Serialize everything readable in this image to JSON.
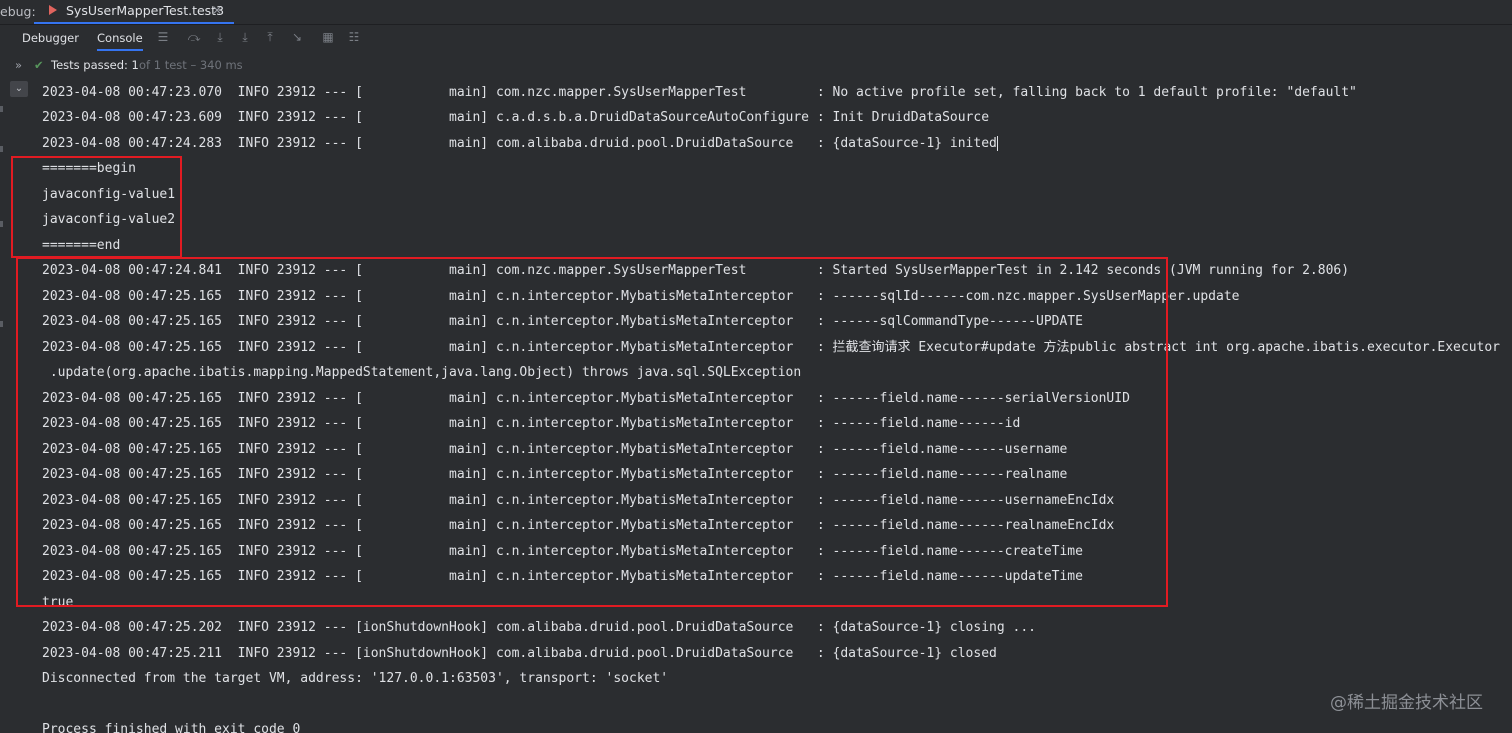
{
  "topbar": {
    "debug_label": "ebug:",
    "tab_label": "SysUserMapperTest.test3",
    "tab_close": "×"
  },
  "toolbar": {
    "debugger_label": "Debugger",
    "console_label": "Console",
    "icons": [
      "menu-icon",
      "step-over-icon",
      "step-into-icon",
      "force-step-into-icon",
      "step-out-icon",
      "run-to-cursor-icon",
      "evaluate-icon",
      "settings-icon"
    ]
  },
  "status": {
    "passed_label": "Tests passed: 1",
    "extra_label": "of 1 test – 340 ms"
  },
  "console": {
    "lines": [
      "2023-04-08 00:47:23.070  INFO 23912 --- [           main] com.nzc.mapper.SysUserMapperTest         : No active profile set, falling back to 1 default profile: \"default\"",
      "2023-04-08 00:47:23.609  INFO 23912 --- [           main] c.a.d.s.b.a.DruidDataSourceAutoConfigure : Init DruidDataSource",
      "2023-04-08 00:47:24.283  INFO 23912 --- [           main] com.alibaba.druid.pool.DruidDataSource   : {dataSource-1} inited",
      "=======begin",
      "javaconfig-value1",
      "javaconfig-value2",
      "=======end",
      "2023-04-08 00:47:24.841  INFO 23912 --- [           main] com.nzc.mapper.SysUserMapperTest         : Started SysUserMapperTest in 2.142 seconds (JVM running for 2.806)",
      "2023-04-08 00:47:25.165  INFO 23912 --- [           main] c.n.interceptor.MybatisMetaInterceptor   : ------sqlId------com.nzc.mapper.SysUserMapper.update",
      "2023-04-08 00:47:25.165  INFO 23912 --- [           main] c.n.interceptor.MybatisMetaInterceptor   : ------sqlCommandType------UPDATE",
      "2023-04-08 00:47:25.165  INFO 23912 --- [           main] c.n.interceptor.MybatisMetaInterceptor   : 拦截查询请求 Executor#update 方法public abstract int org.apache.ibatis.executor.Executor",
      " .update(org.apache.ibatis.mapping.MappedStatement,java.lang.Object) throws java.sql.SQLException",
      "2023-04-08 00:47:25.165  INFO 23912 --- [           main] c.n.interceptor.MybatisMetaInterceptor   : ------field.name------serialVersionUID",
      "2023-04-08 00:47:25.165  INFO 23912 --- [           main] c.n.interceptor.MybatisMetaInterceptor   : ------field.name------id",
      "2023-04-08 00:47:25.165  INFO 23912 --- [           main] c.n.interceptor.MybatisMetaInterceptor   : ------field.name------username",
      "2023-04-08 00:47:25.165  INFO 23912 --- [           main] c.n.interceptor.MybatisMetaInterceptor   : ------field.name------realname",
      "2023-04-08 00:47:25.165  INFO 23912 --- [           main] c.n.interceptor.MybatisMetaInterceptor   : ------field.name------usernameEncIdx",
      "2023-04-08 00:47:25.165  INFO 23912 --- [           main] c.n.interceptor.MybatisMetaInterceptor   : ------field.name------realnameEncIdx",
      "2023-04-08 00:47:25.165  INFO 23912 --- [           main] c.n.interceptor.MybatisMetaInterceptor   : ------field.name------createTime",
      "2023-04-08 00:47:25.165  INFO 23912 --- [           main] c.n.interceptor.MybatisMetaInterceptor   : ------field.name------updateTime",
      "true",
      "2023-04-08 00:47:25.202  INFO 23912 --- [ionShutdownHook] com.alibaba.druid.pool.DruidDataSource   : {dataSource-1} closing ...",
      "2023-04-08 00:47:25.211  INFO 23912 --- [ionShutdownHook] com.alibaba.druid.pool.DruidDataSource   : {dataSource-1} closed",
      "Disconnected from the target VM, address: '127.0.0.1:63503', transport: 'socket'",
      "",
      "Process finished with exit code 0"
    ]
  },
  "watermark": "@稀土掘金技术社区",
  "colors": {
    "background": "#2b2d30",
    "text": "#dfe1e5",
    "highlight_box": "#e11b22",
    "accent": "#3574f0",
    "pass_check": "#57965c"
  }
}
